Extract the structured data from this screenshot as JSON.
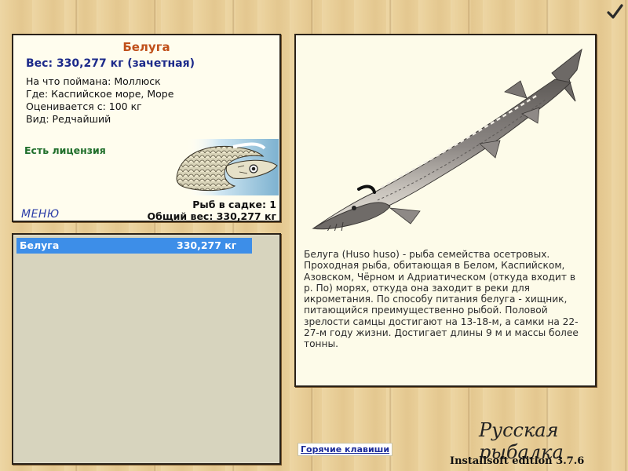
{
  "info": {
    "title": "Белуга",
    "weight": "Вес: 330,277 кг (зачетная)",
    "facts": [
      "На что поймана: Моллюск",
      "Где: Каспийское море, Море",
      "Оценивается с: 100 кг",
      "Вид: Редчайший"
    ],
    "license": "Есть лицензия",
    "menu": "МЕНЮ",
    "fish_in_cage": "Рыб в садке: 1",
    "total_weight": "Общий вес: 330,277 кг"
  },
  "catch_list": [
    {
      "name": "Белуга",
      "weight": "330,277 кг"
    }
  ],
  "description": "Белуга (Huso huso) - рыба семейства осетровых. Проходная рыба, обитающая в Белом, Каспийском, Азовском, Чёрном и Адриатическом (откуда входит в р. По) морях, откуда она заходит в реки для икрометания. По способу питания белуга - хищник, питающийся преимущественно рыбой. Половой зрелости самцы достигают на 13-18-м, а самки на 22-27-м году жизни. Достигает длины 9 м и массы более тонны.",
  "footer": {
    "hotkeys": "Горячие клавиши",
    "brand": "Русская рыбалка",
    "edition": "Installsoft edition 3.7.6"
  },
  "icons": {
    "confirm": "checkmark-icon",
    "bait": "mollusk-bait-illustration",
    "fish": "beluga-sturgeon-illustration"
  },
  "colors": {
    "title": "#c0501a",
    "weight": "#1c2a8a",
    "license": "#1f6e2a",
    "selection": "#3d8ee8"
  }
}
